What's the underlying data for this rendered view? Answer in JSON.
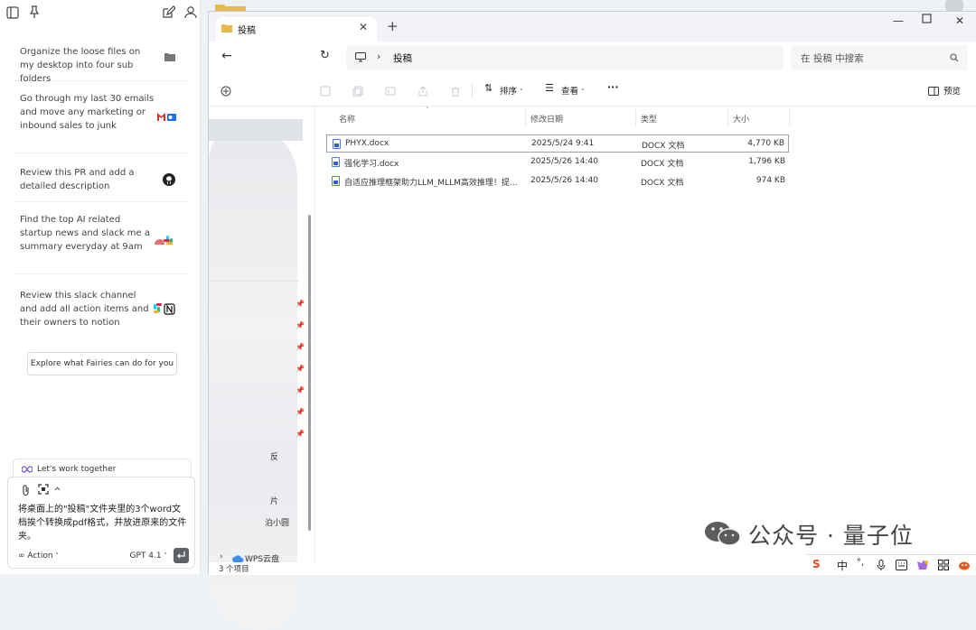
{
  "assistant": {
    "tasks": [
      {
        "text": "Organize the loose files on my desktop into four sub folders",
        "icon": "folder-icon"
      },
      {
        "text": "Go through my last 30 emails and move any marketing or inbound sales to junk",
        "icon": "gmail-outlook-icon"
      },
      {
        "text": "Review this PR and add a detailed description",
        "icon": "github-icon"
      },
      {
        "text": "Find the top AI related startup news and slack me a summary everyday at 9am",
        "icon": "slack-icon"
      },
      {
        "text": "Review this slack channel and add all action items and their owners to notion",
        "icon": "slack-notion-icon"
      }
    ],
    "explore_label": "Explore what Fairies can do for you",
    "lets_work": "Let's work together",
    "message": "将桌面上的\"投稿\"文件夹里的3个word文档挨个转换成pdf格式，并放进原来的文件夹。",
    "action_label": "∞ Action",
    "model_label": "GPT 4.1"
  },
  "explorer": {
    "tab_title": "投稿",
    "breadcrumb": "投稿",
    "search_placeholder": "在 投稿 中搜索",
    "sort_label": "排序",
    "view_label": "查看",
    "more_label": "···",
    "preview_label": "预览",
    "columns": {
      "name": "名称",
      "modified": "修改日期",
      "type": "类型",
      "size": "大小"
    },
    "files": [
      {
        "name": "PHYX.docx",
        "modified": "2025/5/24 9:41",
        "type": "DOCX 文档",
        "size": "4,770 KB"
      },
      {
        "name": "强化学习.docx",
        "modified": "2025/5/26 14:40",
        "type": "DOCX 文档",
        "size": "1,796 KB"
      },
      {
        "name": "自适应推理框架助力LLM_MLLM高效推理！提...",
        "modified": "2025/5/26 14:40",
        "type": "DOCX 文档",
        "size": "974 KB"
      }
    ],
    "nav_fragments": {
      "a": "反",
      "b": "片",
      "c": "泊小圆",
      "cloud": "WPS云盘"
    },
    "status": "3 个项目"
  },
  "watermark": "公众号 · 量子位",
  "taskbar": {
    "ime": "中",
    "punct": "°,"
  }
}
